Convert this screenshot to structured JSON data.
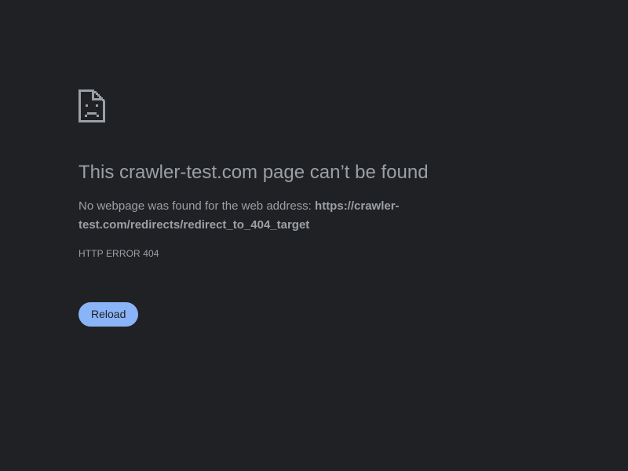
{
  "error_page": {
    "icon": "sad-document-icon",
    "title": "This crawler-test.com page can’t be found",
    "summary_prefix": "No webpage was found for the web address: ",
    "url": "https://crawler-test.com/redirects/redirect_to_404_target",
    "url_line1": "https://crawler-",
    "url_line2": "test.com/redirects/redirect_to_404_target",
    "error_code": "HTTP ERROR 404",
    "reload_label": "Reload"
  },
  "colors": {
    "background": "#202124",
    "text": "#9aa0a6",
    "icon": "#9aa0a6",
    "button": "#8ab4f8",
    "button_text": "#202124"
  }
}
